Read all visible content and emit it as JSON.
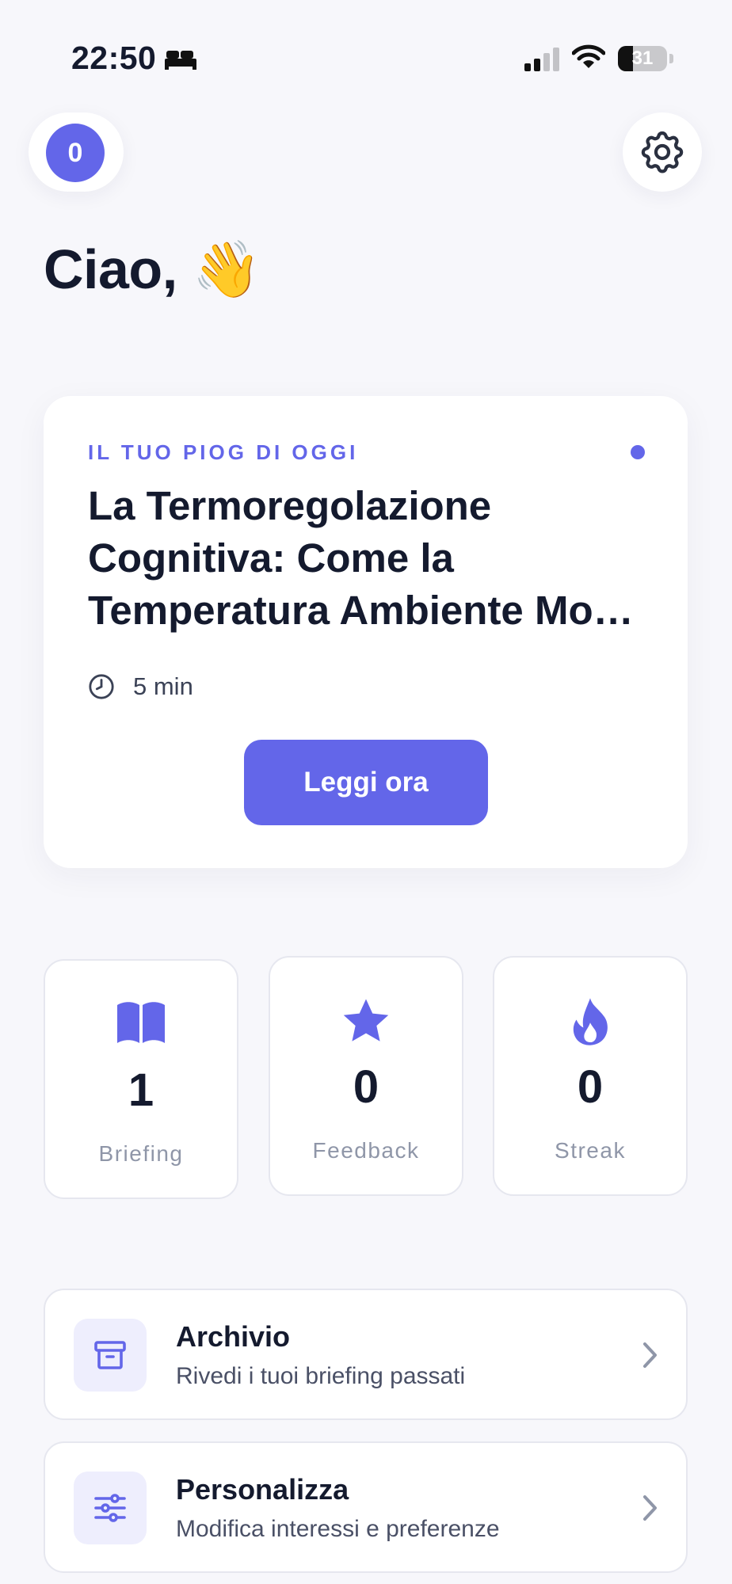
{
  "status_bar": {
    "time": "22:50",
    "battery": "31",
    "battery_level": 0.31
  },
  "header": {
    "avatar_initial": "0"
  },
  "greeting": "Ciao, 👋",
  "today_card": {
    "eyebrow": "IL TUO PIOG DI OGGI",
    "title": "La Termoregolazione Cognitiva: Come la Temperatura Ambiente Mo…",
    "read_time": "5 min",
    "cta": "Leggi ora"
  },
  "stats": [
    {
      "icon": "book-icon",
      "value": "1",
      "label": "Briefing"
    },
    {
      "icon": "star-icon",
      "value": "0",
      "label": "Feedback"
    },
    {
      "icon": "flame-icon",
      "value": "0",
      "label": "Streak"
    }
  ],
  "menu": [
    {
      "icon": "archive-icon",
      "title": "Archivio",
      "subtitle": "Rivedi i tuoi briefing passati"
    },
    {
      "icon": "sliders-icon",
      "title": "Personalizza",
      "subtitle": "Modifica interessi e preferenze"
    }
  ],
  "colors": {
    "accent": "#6366e9",
    "background": "#f7f7fb",
    "text": "#141a2e",
    "muted": "#8f96a8"
  }
}
